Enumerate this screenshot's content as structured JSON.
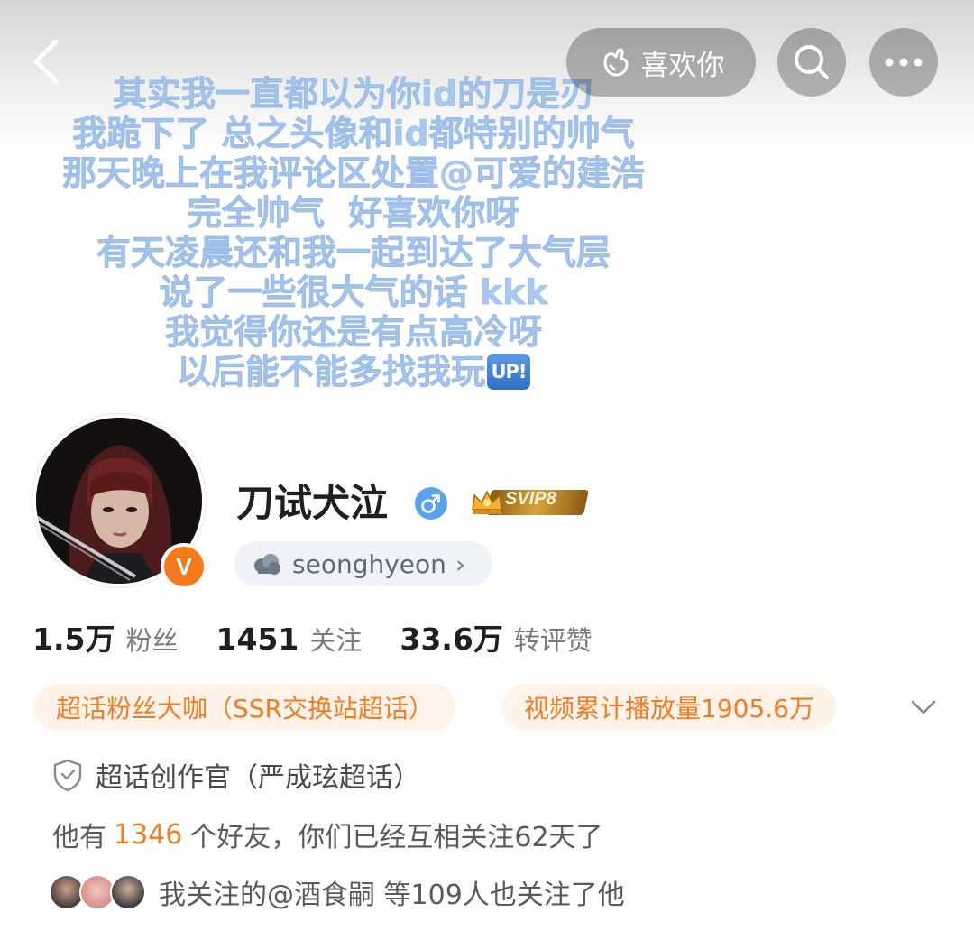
{
  "header": {
    "like_label": "喜欢你"
  },
  "cover": {
    "lines": [
      "其实我一直都以为你id的刀是刃",
      "我跪下了 总之头像和id都特别的帅气",
      "那天晚上在我评论区处置@可爱的建浩",
      "完全帅气  好喜欢你呀",
      "有天凌晨还和我一起到达了大气层",
      "说了一些很大气的话 kkk",
      "我觉得你还是有点高冷呀",
      "以后能不能多找我玩"
    ],
    "up_emoji": "UP!"
  },
  "profile": {
    "username": "刀试犬泣",
    "gender": "male",
    "svip_label": "SVIP8",
    "verified_badge": "V",
    "handle": "seonghyeon",
    "handle_chevron": "›"
  },
  "stats": [
    {
      "num": "1.5万",
      "label": "粉丝"
    },
    {
      "num": "1451",
      "label": "关注"
    },
    {
      "num": "33.6万",
      "label": "转评赞"
    }
  ],
  "tags": [
    "超话粉丝大咖（SSR交换站超话）",
    "视频累计播放量1905.6万"
  ],
  "creator": {
    "text": "超话创作官（严成玹超话）"
  },
  "friends": {
    "prefix": "他有",
    "count": "1346",
    "suffix": "个好友，你们已经互相关注62天了"
  },
  "mutual": {
    "text": "我关注的@酒食嗣 等109人也关注了他"
  },
  "colors": {
    "accent_orange": "#f07d24",
    "cover_text": "#a9c8ee",
    "tag_bg": "#fff2e8"
  },
  "icons": [
    "back-icon",
    "like-hand-icon",
    "search-icon",
    "more-icon",
    "male-icon",
    "crown-icon",
    "cloud-icon",
    "chevron-down-icon",
    "shield-icon"
  ]
}
